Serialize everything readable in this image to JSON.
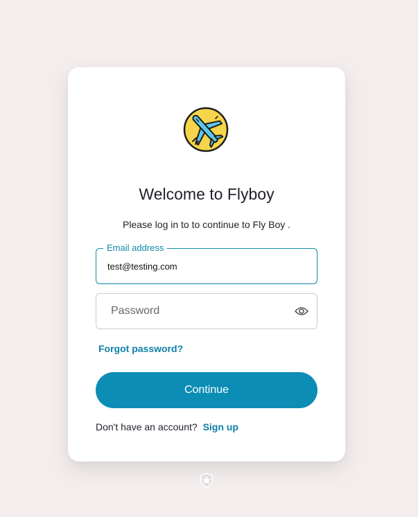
{
  "page": {
    "background_color": "#f3eded",
    "accent_color": "#0b8db5"
  },
  "logo": {
    "icon": "airplane-icon",
    "background_color": "#f7d54a",
    "plane_color": "#5ec8ea"
  },
  "login": {
    "title": "Welcome to Flyboy",
    "subtitle": "Please log in to to continue to Fly Boy ."
  },
  "email": {
    "label": "Email address",
    "value": "test@testing.com"
  },
  "password": {
    "placeholder": "Password",
    "value": "",
    "toggle_icon": "eye-icon"
  },
  "forgot_password": {
    "label": "Forgot password?"
  },
  "continue_button": {
    "label": "Continue"
  },
  "signup": {
    "prompt": "Don't have an account?",
    "link_label": "Sign up"
  },
  "footer": {
    "badge_icon": "shield-star-icon"
  }
}
